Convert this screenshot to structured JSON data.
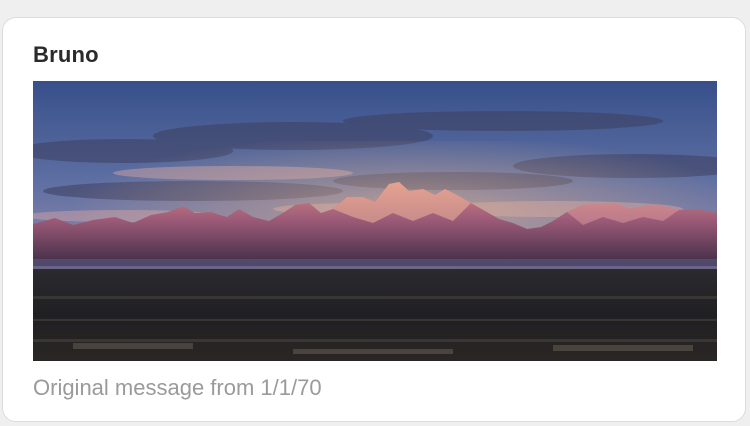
{
  "message": {
    "sender_name": "Bruno",
    "attachment": {
      "kind": "image",
      "subject": "mountain range at sunrise"
    },
    "footer_text": "Original message from 1/1/70"
  },
  "colors": {
    "background": "#efefef",
    "card": "#ffffff",
    "sender_text": "#2a2a2a",
    "footer_text": "#9a9a9a"
  }
}
